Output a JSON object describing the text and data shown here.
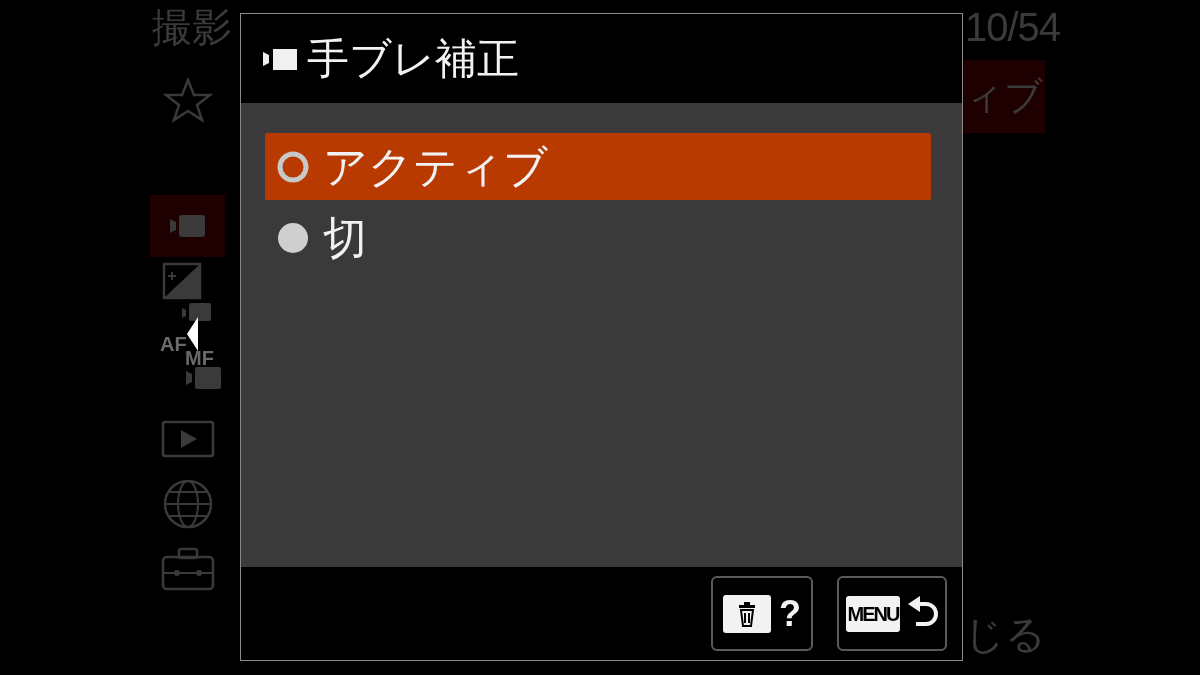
{
  "menu": {
    "breadcrumb": "撮影",
    "page": "10/54",
    "current_value": "ィブ",
    "close_label": "じる",
    "tabs": [
      {
        "kind": "favorites",
        "selected": false
      },
      {
        "kind": "movie",
        "selected": true
      },
      {
        "kind": "exposure",
        "selected": false
      },
      {
        "kind": "focus",
        "selected": false,
        "labels": [
          "AF",
          "MF"
        ]
      },
      {
        "kind": "playback",
        "selected": false
      },
      {
        "kind": "network",
        "selected": false
      },
      {
        "kind": "setup",
        "selected": false
      }
    ]
  },
  "dialog": {
    "title": "手ブレ補正",
    "options": [
      {
        "label": "アクティブ",
        "selected": true
      },
      {
        "label": "切",
        "selected": false
      }
    ],
    "buttons": [
      {
        "kind": "help",
        "label": "?"
      },
      {
        "kind": "back",
        "key_label": "MENU"
      }
    ]
  }
}
